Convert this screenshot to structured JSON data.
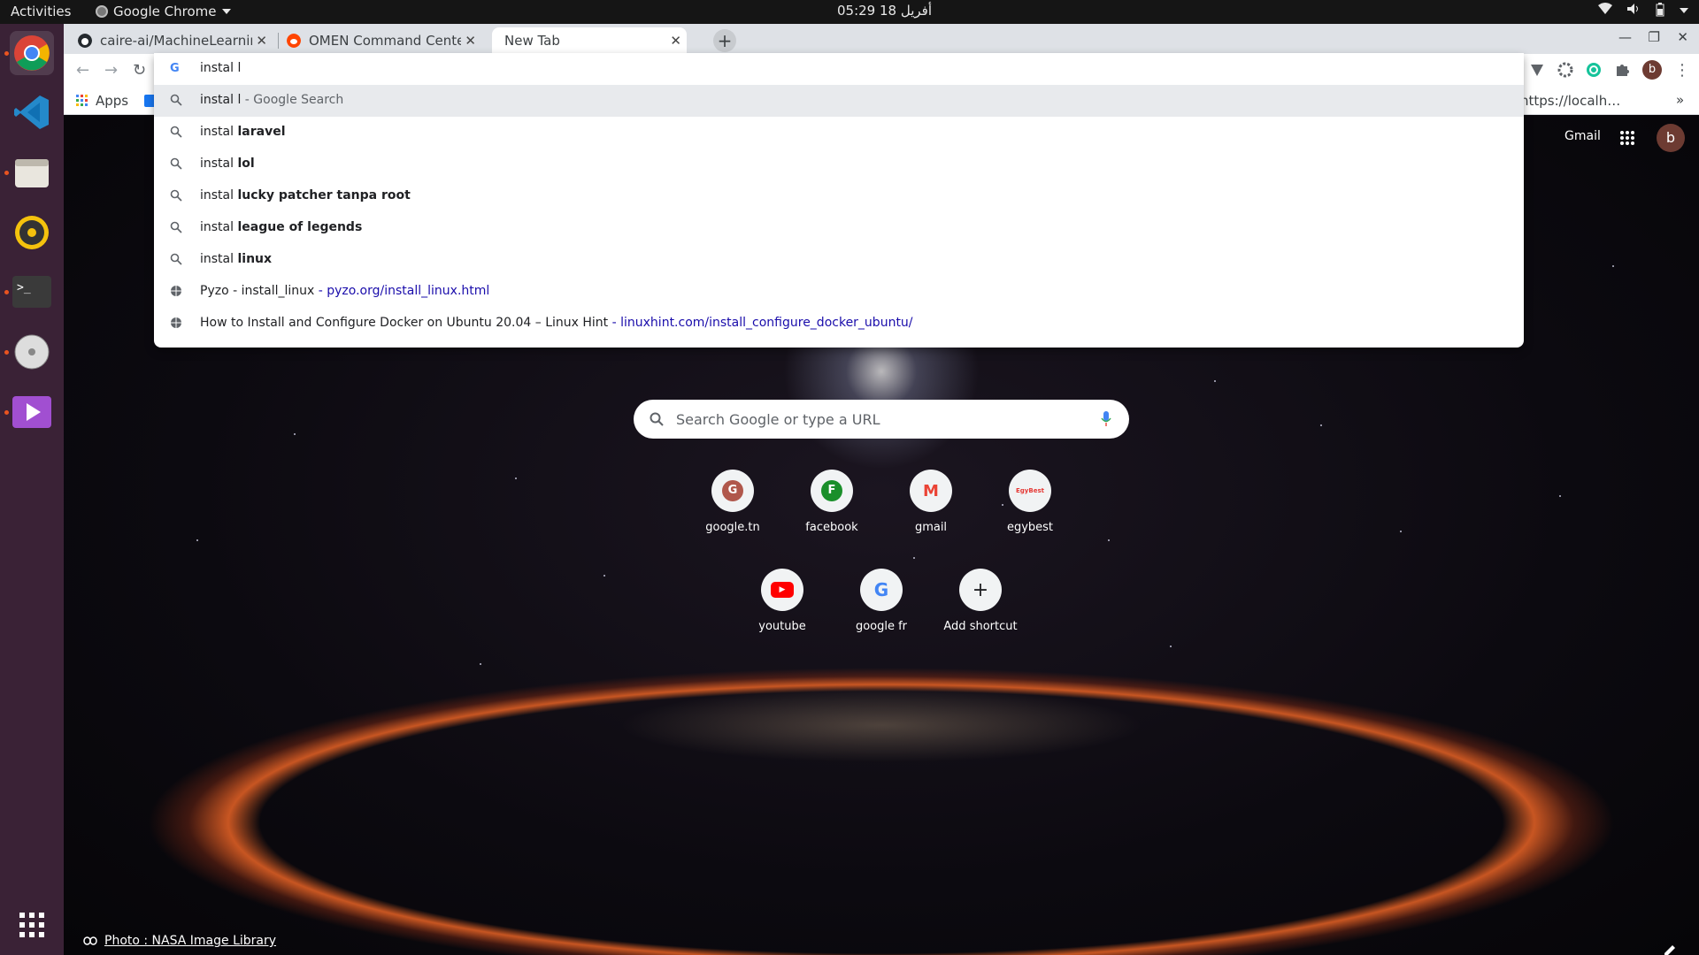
{
  "system": {
    "activities": "Activities",
    "app_name": "Google Chrome",
    "clock": "05:29  أفريل 18"
  },
  "dock": {
    "apps": [
      "chrome",
      "vscode",
      "files",
      "rhythmbox",
      "terminal",
      "disks",
      "media-player"
    ]
  },
  "tabs": [
    {
      "label": "caire-ai/MachineLearning"
    },
    {
      "label": "OMEN Command Center"
    },
    {
      "label": "New Tab"
    }
  ],
  "bookmarks": {
    "apps_label": "Apps",
    "overflow_label": "https://localh…"
  },
  "omnibox": {
    "value": "instal l"
  },
  "suggestions": [
    {
      "typed": "instal l",
      "bold": "",
      "suffix": " - Google Search",
      "type": "search"
    },
    {
      "typed": "instal ",
      "bold": "laravel",
      "suffix": "",
      "type": "search"
    },
    {
      "typed": "instal ",
      "bold": "lol",
      "suffix": "",
      "type": "search"
    },
    {
      "typed": "instal ",
      "bold": "lucky patcher tanpa root",
      "suffix": "",
      "type": "search"
    },
    {
      "typed": "instal ",
      "bold": "league of legends",
      "suffix": "",
      "type": "search"
    },
    {
      "typed": "instal ",
      "bold": "linux",
      "suffix": "",
      "type": "search"
    },
    {
      "text": "Pyzo - install_linux",
      "url": " - pyzo.org/install_linux.html",
      "type": "page"
    },
    {
      "text": "How to Install and Configure Docker on Ubuntu 20.04 – Linux Hint",
      "url": " - linuxhint.com/install_configure_docker_ubuntu/",
      "type": "page"
    }
  ],
  "newtab": {
    "gmail": "Gmail",
    "avatar": "b",
    "search_placeholder": "Search Google or type a URL",
    "shortcuts": [
      {
        "label": "google.tn",
        "letter": "G"
      },
      {
        "label": "facebook",
        "letter": "F"
      },
      {
        "label": "gmail",
        "letter": "M"
      },
      {
        "label": "egybest",
        "letter": "EgyBest"
      },
      {
        "label": "youtube",
        "letter": "▶"
      },
      {
        "label": "google fr",
        "letter": "G"
      },
      {
        "label": "Add shortcut",
        "letter": "+"
      }
    ],
    "credit": "Photo : NASA Image Library"
  },
  "colors": {
    "dock": "#3a2236",
    "accent": "#e95420",
    "tabstrip": "#dee1e6"
  }
}
